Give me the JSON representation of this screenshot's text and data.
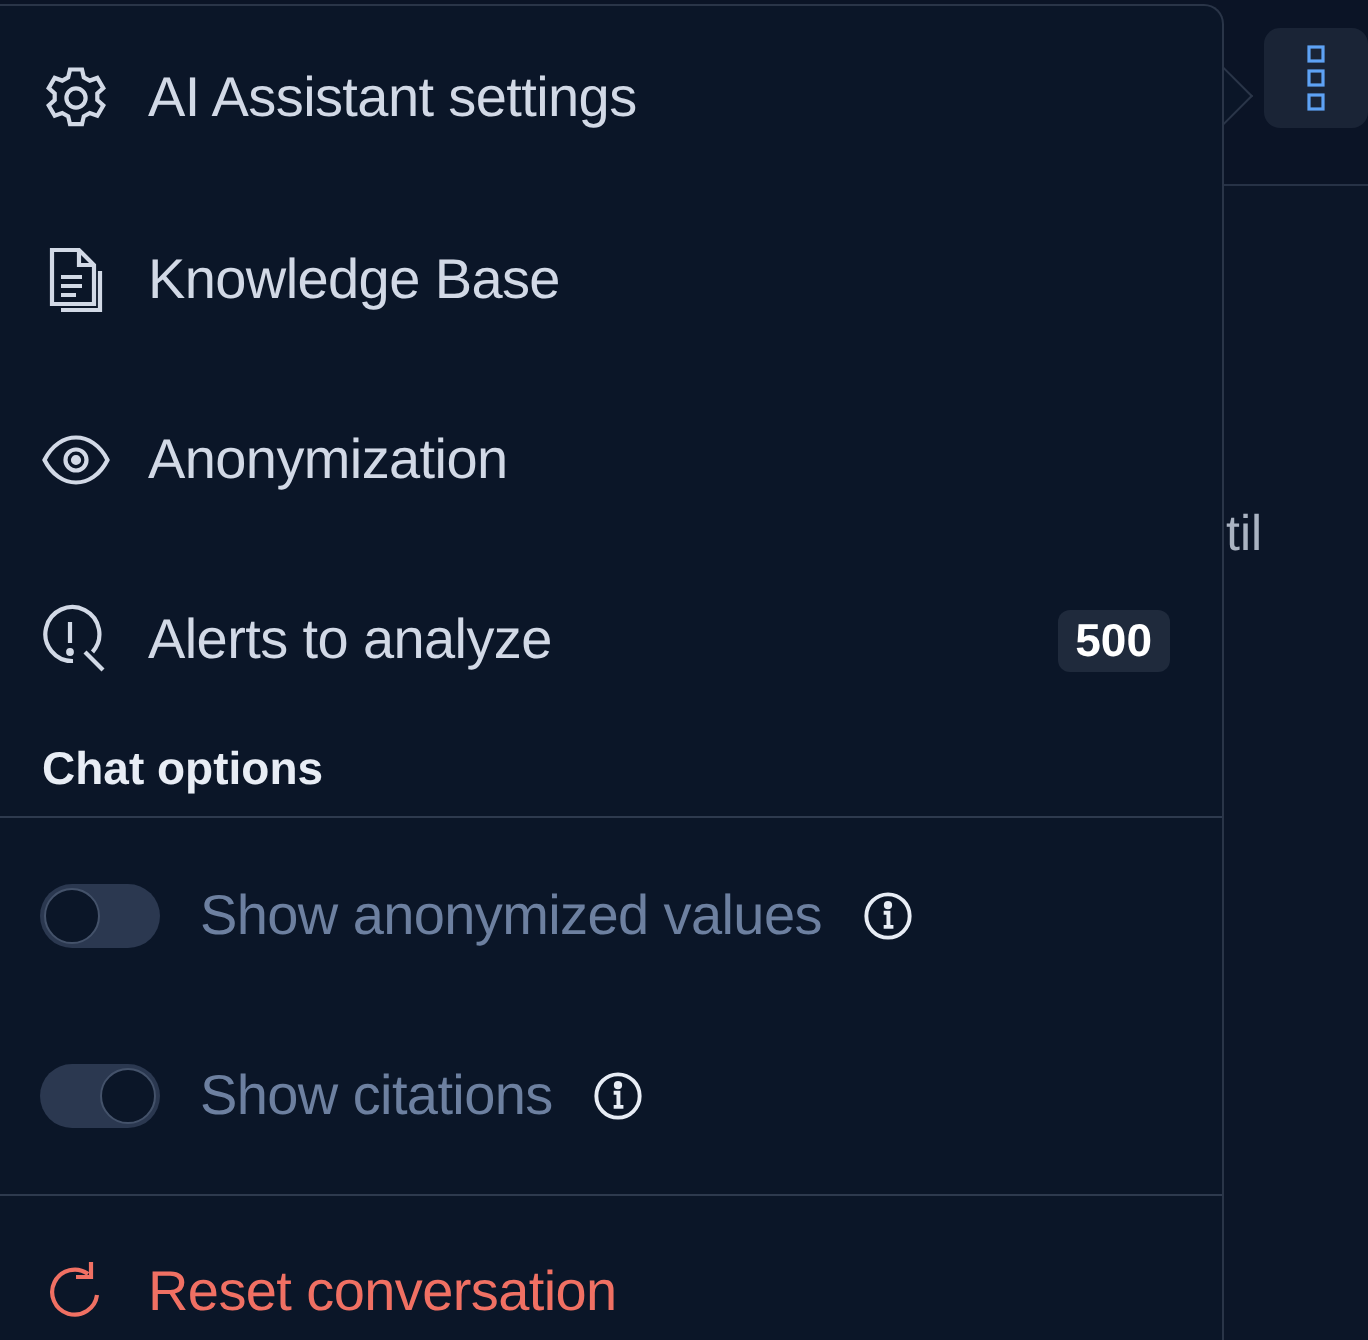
{
  "background": {
    "text_fragment": "til"
  },
  "menu": {
    "items": [
      {
        "kind": "gear",
        "label": "AI Assistant settings"
      },
      {
        "kind": "document",
        "label": "Knowledge Base"
      },
      {
        "kind": "eye",
        "label": "Anonymization"
      },
      {
        "kind": "alert-search",
        "label": "Alerts to analyze",
        "badge": "500"
      }
    ],
    "section_title": "Chat options",
    "toggles": [
      {
        "label": "Show anonymized values",
        "on": false,
        "disabled": true
      },
      {
        "label": "Show citations",
        "on": true,
        "disabled": true
      }
    ],
    "reset": {
      "label": "Reset conversation"
    }
  }
}
